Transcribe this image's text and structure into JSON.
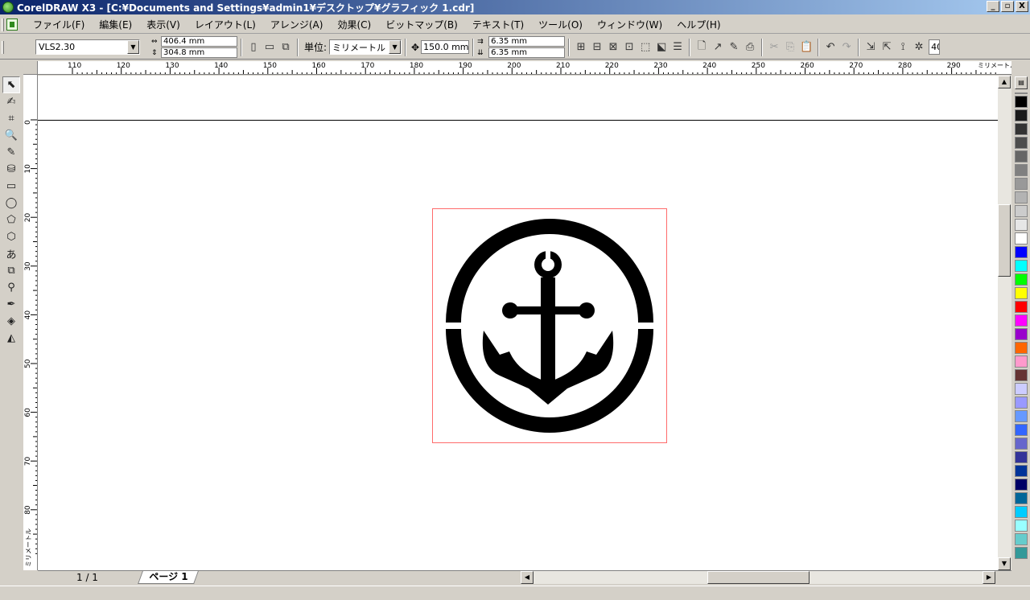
{
  "window": {
    "title": "CorelDRAW X3 - [C:¥Documents and Settings¥admin1¥デスクトップ¥グラフィック 1.cdr]",
    "buttons": {
      "minimize": "_",
      "restore": "▫",
      "close": "X"
    }
  },
  "menu": [
    {
      "label": "ファイル(F)"
    },
    {
      "label": "編集(E)"
    },
    {
      "label": "表示(V)"
    },
    {
      "label": "レイアウト(L)"
    },
    {
      "label": "アレンジ(A)"
    },
    {
      "label": "効果(C)"
    },
    {
      "label": "ビットマップ(B)"
    },
    {
      "label": "テキスト(T)"
    },
    {
      "label": "ツール(O)"
    },
    {
      "label": "ウィンドウ(W)"
    },
    {
      "label": "ヘルプ(H)"
    }
  ],
  "propbar": {
    "paper_preset": "VLS2.30",
    "width": "406.4 mm",
    "height": "304.8 mm",
    "units_label": "単位:",
    "units_value": "ミリメートル",
    "nudge": "150.0 mm",
    "dup_x": "6.35 mm",
    "dup_y": "6.35 mm",
    "zoom": "40"
  },
  "rulers": {
    "h_ticks": [
      "110",
      "120",
      "130",
      "140",
      "150",
      "160",
      "170",
      "180",
      "190",
      "200",
      "210",
      "220",
      "230",
      "240",
      "250",
      "260",
      "270",
      "280",
      "290"
    ],
    "h_unit": "ミリメートル",
    "v_ticks": [
      "0",
      "10",
      "20",
      "30",
      "40",
      "50",
      "60",
      "70",
      "80"
    ],
    "v_unit": "ミリメートル"
  },
  "pages": {
    "counter": "1 / 1",
    "tab": "ページ 1"
  },
  "palette": {
    "colors": [
      "#000000",
      "#1a1a1a",
      "#333333",
      "#4d4d4d",
      "#666666",
      "#808080",
      "#999999",
      "#b3b3b3",
      "#cccccc",
      "#e6e6e6",
      "#ffffff",
      "#0000ff",
      "#00ffff",
      "#00ff00",
      "#ffff00",
      "#ff0000",
      "#ff00ff",
      "#9900cc",
      "#ff6600",
      "#ff99cc",
      "#663333",
      "#ccccff",
      "#9999ff",
      "#6699ff",
      "#3366ff",
      "#6666cc",
      "#333399",
      "#003399",
      "#000066",
      "#006699",
      "#00ccff",
      "#99ffff",
      "#66cccc",
      "#339999"
    ]
  },
  "tools": [
    "pick-tool-icon",
    "shape-tool-icon",
    "crop-tool-icon",
    "zoom-tool-icon",
    "freehand-tool-icon",
    "smart-fill-icon",
    "rectangle-tool-icon",
    "ellipse-tool-icon",
    "polygon-tool-icon",
    "basic-shapes-icon",
    "text-tool-icon",
    "interactive-blend-icon",
    "eyedropper-icon",
    "outline-pen-icon",
    "fill-tool-icon",
    "interactive-fill-icon"
  ]
}
